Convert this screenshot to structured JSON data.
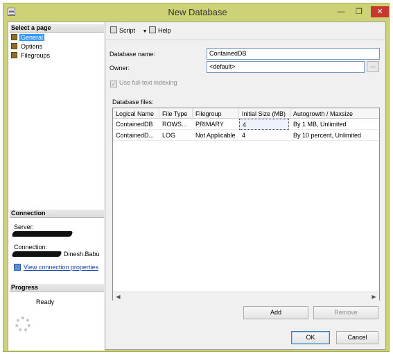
{
  "window": {
    "title": "New Database",
    "close_glyph": "✕",
    "min_glyph": "—",
    "max_glyph": "❐"
  },
  "left_panel": {
    "select_page_header": "Select a page",
    "pages": [
      "General",
      "Options",
      "Filegroups"
    ],
    "selected_page": "General",
    "connection_header": "Connection",
    "server_label": "Server:",
    "connection_label": "Connection:",
    "connection_value_visible": "Dinesh.Babu",
    "view_connection_link": "View connection properties",
    "progress_header": "Progress",
    "progress_status": "Ready"
  },
  "toolbar": {
    "script_label": "Script",
    "help_label": "Help"
  },
  "form": {
    "database_name_label": "Database name:",
    "database_name_value": "ContainedDB",
    "owner_label": "Owner:",
    "owner_value": "<default>",
    "browse_label": "...",
    "fulltext_label": "Use full-text indexing",
    "fulltext_checked": true,
    "fulltext_check_glyph": "✓",
    "database_files_label": "Database files:"
  },
  "grid": {
    "columns": [
      "Logical Name",
      "File Type",
      "Filegroup",
      "Initial Size (MB)",
      "Autogrowth / Maxsize"
    ],
    "rows": [
      [
        "ContainedDB",
        "ROWS...",
        "PRIMARY",
        "4",
        "By 1 MB, Unlimited"
      ],
      [
        "ContainedD...",
        "LOG",
        "Not Applicable",
        "4",
        "By 10 percent, Unlimited"
      ]
    ],
    "scroll_left": "◀",
    "scroll_right": "▶"
  },
  "buttons": {
    "add": "Add",
    "remove": "Remove",
    "ok": "OK",
    "cancel": "Cancel"
  },
  "icons": {
    "script": "script-icon",
    "help": "help-icon",
    "page": "page-icon",
    "connection": "connection-properties-icon",
    "progress": "progress-spinner-icon"
  }
}
